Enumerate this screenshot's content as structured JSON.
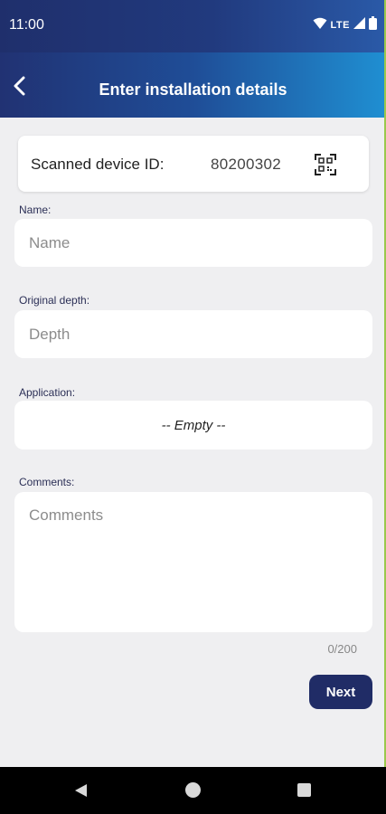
{
  "status_bar": {
    "time": "11:00",
    "network_label": "LTE",
    "icons": [
      "wifi-icon",
      "signal-icon",
      "battery-icon"
    ]
  },
  "app_bar": {
    "title": "Enter installation details",
    "back_icon": "chevron-left-icon"
  },
  "scanned_device": {
    "label": "Scanned device ID:",
    "value": "80200302",
    "icon": "qr-scan-icon"
  },
  "form": {
    "name": {
      "label": "Name:",
      "placeholder": "Name",
      "value": ""
    },
    "depth": {
      "label": "Original depth:",
      "placeholder": "Depth",
      "value": ""
    },
    "application": {
      "label": "Application:",
      "selected": "-- Empty --"
    },
    "comments": {
      "label": "Comments:",
      "placeholder": "Comments",
      "value": "",
      "counter": "0/200"
    }
  },
  "actions": {
    "next_label": "Next"
  },
  "nav_bar": {
    "icons": [
      "nav-back-icon",
      "nav-home-icon",
      "nav-recents-icon"
    ]
  },
  "colors": {
    "app_bar_start": "#213273",
    "app_bar_end": "#1f8fd2",
    "button": "#202c66",
    "background": "#efeff1",
    "label": "#2b2f56"
  }
}
